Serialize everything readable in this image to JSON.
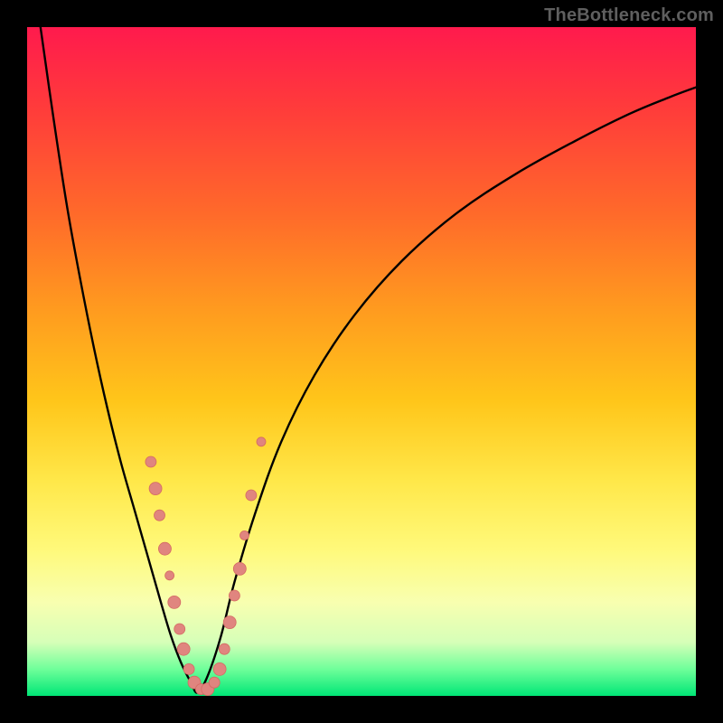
{
  "watermark": "TheBottleneck.com",
  "colors": {
    "curve": "#000000",
    "dot_fill": "#e0857f",
    "dot_stroke": "#d46a62"
  },
  "chart_data": {
    "type": "line",
    "title": "",
    "xlabel": "",
    "ylabel": "",
    "xlim": [
      0,
      100
    ],
    "ylim": [
      0,
      100
    ],
    "grid": false,
    "legend": false,
    "notes": "Bottleneck-style V-curve. Axes are normalized 0–100 (no tick labels are shown in the image). y≈0 is the green optimum band at the bottom; y≈100 is deep red at top. Scatter points cluster near the valley.",
    "series": [
      {
        "name": "left-arm",
        "x": [
          2,
          4,
          6,
          8,
          10,
          12,
          14,
          16,
          18,
          20,
          21.5,
          23,
          24.5,
          25.5
        ],
        "values": [
          100,
          86,
          73,
          62,
          52,
          43,
          35,
          28,
          21,
          14,
          9,
          5,
          2,
          0.5
        ]
      },
      {
        "name": "right-arm",
        "x": [
          25.5,
          27,
          29,
          31,
          34,
          38,
          43,
          49,
          56,
          64,
          73,
          82,
          90,
          96,
          100
        ],
        "values": [
          0.5,
          3,
          9,
          17,
          27,
          38,
          48,
          57,
          65,
          72,
          78,
          83,
          87,
          89.5,
          91
        ]
      }
    ],
    "scatter": {
      "name": "sample-points",
      "points": [
        {
          "x": 18.5,
          "y": 35,
          "r": 6
        },
        {
          "x": 19.2,
          "y": 31,
          "r": 7
        },
        {
          "x": 19.8,
          "y": 27,
          "r": 6
        },
        {
          "x": 20.6,
          "y": 22,
          "r": 7
        },
        {
          "x": 21.3,
          "y": 18,
          "r": 5
        },
        {
          "x": 22.0,
          "y": 14,
          "r": 7
        },
        {
          "x": 22.8,
          "y": 10,
          "r": 6
        },
        {
          "x": 23.4,
          "y": 7,
          "r": 7
        },
        {
          "x": 24.2,
          "y": 4,
          "r": 6
        },
        {
          "x": 25.0,
          "y": 2,
          "r": 7
        },
        {
          "x": 26.0,
          "y": 1,
          "r": 6
        },
        {
          "x": 27.0,
          "y": 1,
          "r": 7
        },
        {
          "x": 28.0,
          "y": 2,
          "r": 6
        },
        {
          "x": 28.8,
          "y": 4,
          "r": 7
        },
        {
          "x": 29.5,
          "y": 7,
          "r": 6
        },
        {
          "x": 30.3,
          "y": 11,
          "r": 7
        },
        {
          "x": 31.0,
          "y": 15,
          "r": 6
        },
        {
          "x": 31.8,
          "y": 19,
          "r": 7
        },
        {
          "x": 32.5,
          "y": 24,
          "r": 5
        },
        {
          "x": 33.5,
          "y": 30,
          "r": 6
        },
        {
          "x": 35.0,
          "y": 38,
          "r": 5
        }
      ]
    }
  }
}
